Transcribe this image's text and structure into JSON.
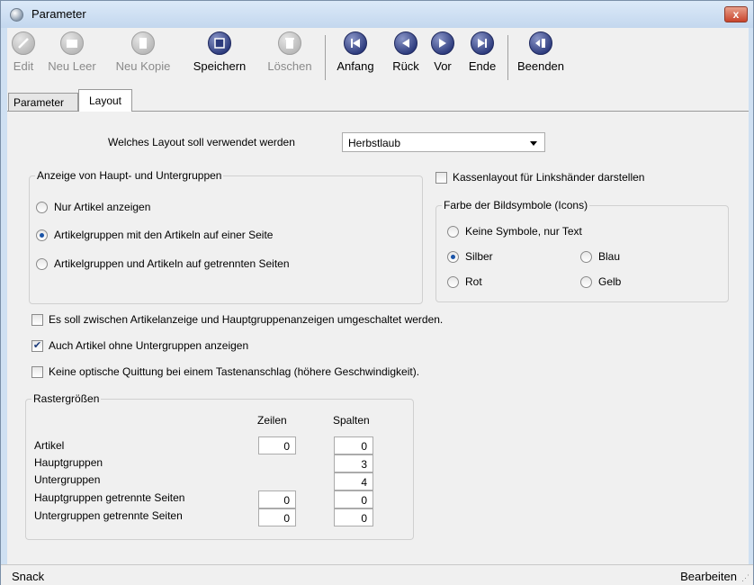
{
  "window": {
    "title": "Parameter",
    "close_label": "x"
  },
  "toolbar": {
    "edit": "Edit",
    "neu_leer": "Neu Leer",
    "neu_kopie": "Neu Kopie",
    "speichern": "Speichern",
    "loeschen": "Löschen",
    "anfang": "Anfang",
    "rueck": "Rück",
    "vor": "Vor",
    "ende": "Ende",
    "beenden": "Beenden"
  },
  "tabs": [
    {
      "label": "Parameter",
      "active": false
    },
    {
      "label": "Layout",
      "active": true
    }
  ],
  "layout": {
    "layout_label": "Welches Layout soll verwendet werden",
    "layout_value": "Herbstlaub",
    "gruppen": {
      "title": "Anzeige von Haupt- und Untergruppen",
      "options": [
        "Nur Artikel anzeigen",
        "Artikelgruppen mit den Artikeln auf einer Seite",
        "Artikelgruppen und Artikeln auf getrennten Seiten"
      ],
      "selected_index": 1
    },
    "linkshaender": {
      "label": "Kassenlayout für Linkshänder darstellen",
      "checked": false
    },
    "farbe": {
      "title": "Farbe der Bildsymbole (Icons)",
      "keine": "Keine Symbole, nur Text",
      "silber": "Silber",
      "blau": "Blau",
      "rot": "Rot",
      "gelb": "Gelb",
      "selected": "Silber"
    },
    "checks": [
      {
        "label": "Es soll zwischen Artikelanzeige und Hauptgruppenanzeigen umgeschaltet werden.",
        "checked": false
      },
      {
        "label": "Auch Artikel ohne Untergruppen anzeigen",
        "checked": true
      },
      {
        "label": "Keine optische Quittung bei einem Tastenanschlag (höhere Geschwindigkeit).",
        "checked": false
      }
    ],
    "raster": {
      "title": "Rastergrößen",
      "col_zeilen": "Zeilen",
      "col_spalten": "Spalten",
      "rows": [
        {
          "label": "Artikel",
          "zeilen": "0",
          "spalten": "0"
        },
        {
          "label": "Hauptgruppen",
          "zeilen": null,
          "spalten": "3"
        },
        {
          "label": "Untergruppen",
          "zeilen": null,
          "spalten": "4"
        },
        {
          "label": "Hauptgruppen getrennte Seiten",
          "zeilen": "0",
          "spalten": "0"
        },
        {
          "label": "Untergruppen getrennte Seiten",
          "zeilen": "0",
          "spalten": "0"
        }
      ]
    }
  },
  "status": {
    "left": "Snack",
    "right": "Bearbeiten"
  }
}
